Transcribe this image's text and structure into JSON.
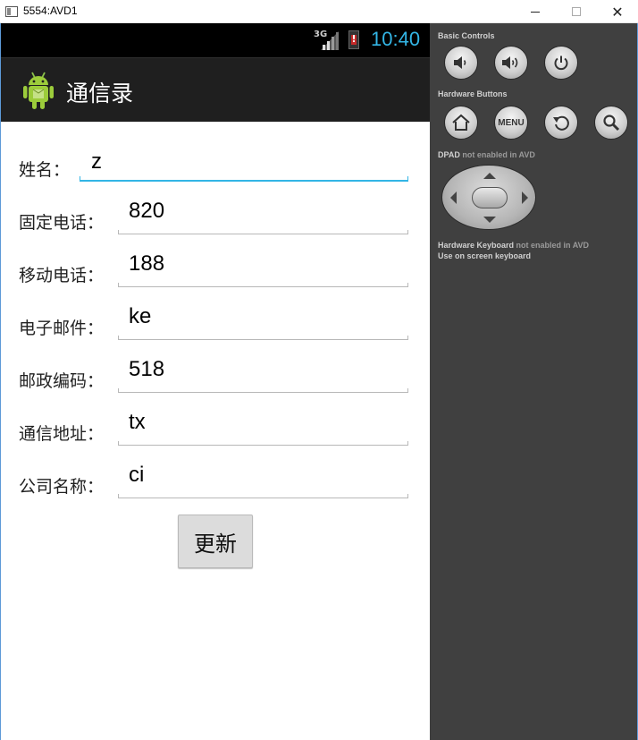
{
  "window": {
    "title": "5554:AVD1",
    "minimize_icon": "minimize-icon",
    "maximize_icon": "maximize-icon",
    "close_icon": "close-icon"
  },
  "statusbar": {
    "network": "3G",
    "time": "10:40",
    "time_color": "#33b5e5"
  },
  "actionbar": {
    "title": "通信录",
    "icon": "android-robot-icon"
  },
  "form": {
    "fields": [
      {
        "label": "姓名：",
        "value": "z"
      },
      {
        "label": "固定电话：",
        "value": "820"
      },
      {
        "label": "移动电话：",
        "value": "188"
      },
      {
        "label": "电子邮件：",
        "value": "ke"
      },
      {
        "label": "邮政编码：",
        "value": "518"
      },
      {
        "label": "通信地址：",
        "value": "tx"
      },
      {
        "label": "公司名称：",
        "value": "ci"
      }
    ],
    "update_button": "更新"
  },
  "panel": {
    "basic_controls_title": "Basic Controls",
    "hardware_buttons_title": "Hardware Buttons",
    "menu_label": "MENU",
    "dpad_title": "DPAD",
    "dpad_note": "not enabled in AVD",
    "keyboard_title": "Hardware Keyboard",
    "keyboard_note": "not enabled in AVD",
    "keyboard_hint": "Use on screen keyboard"
  },
  "colors": {
    "accent": "#33b5e5",
    "panel_bg": "#404040",
    "actionbar_bg": "#1f1f1f"
  }
}
